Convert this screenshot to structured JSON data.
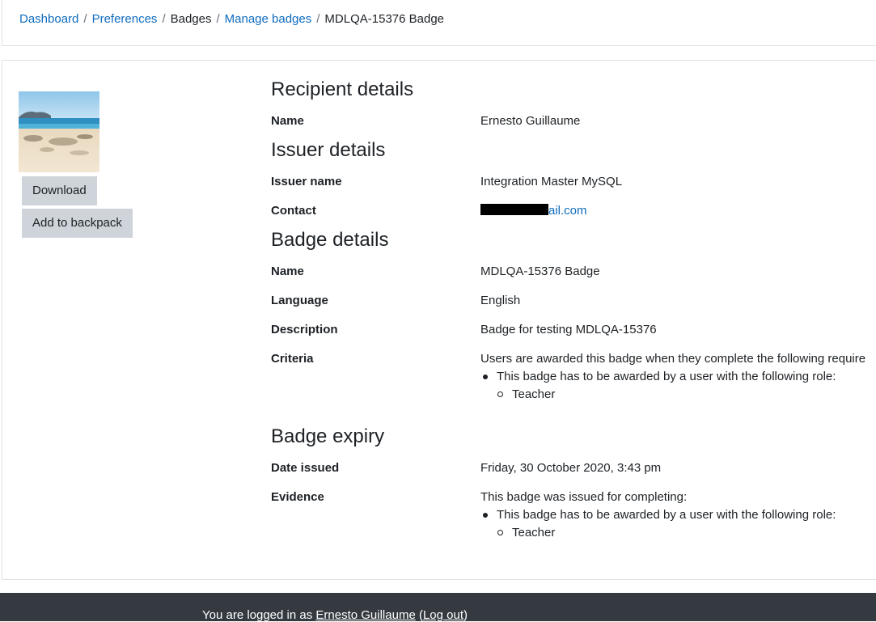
{
  "breadcrumb": {
    "items": [
      "Dashboard",
      "Preferences",
      "Badges",
      "Manage badges",
      "MDLQA-15376 Badge"
    ],
    "separator": "/"
  },
  "buttons": {
    "download": "Download",
    "add_to_backpack": "Add to backpack"
  },
  "recipient": {
    "heading": "Recipient details",
    "name_label": "Name",
    "name_value": "Ernesto Guillaume"
  },
  "issuer": {
    "heading": "Issuer details",
    "issuer_name_label": "Issuer name",
    "issuer_name_value": "Integration Master MySQL",
    "contact_label": "Contact",
    "contact_visible_suffix": "ail.com"
  },
  "badge": {
    "heading": "Badge details",
    "name_label": "Name",
    "name_value": "MDLQA-15376 Badge",
    "language_label": "Language",
    "language_value": "English",
    "description_label": "Description",
    "description_value": "Badge for testing MDLQA-15376",
    "criteria_label": "Criteria",
    "criteria_intro": "Users are awarded this badge when they complete the following require",
    "criteria_item": "This badge has to be awarded by a user with the following role:",
    "criteria_subitem": "Teacher"
  },
  "expiry": {
    "heading": "Badge expiry",
    "date_issued_label": "Date issued",
    "date_issued_value": "Friday, 30 October 2020, 3:43 pm",
    "evidence_label": "Evidence",
    "evidence_intro": "This badge was issued for completing:",
    "evidence_item": "This badge has to be awarded by a user with the following role:",
    "evidence_subitem": "Teacher"
  },
  "footer": {
    "logged_in_prefix": "You are logged in as ",
    "user_name": "Ernesto Guillaume",
    "logout_open": " (",
    "logout_label": "Log out",
    "logout_close": ")"
  }
}
